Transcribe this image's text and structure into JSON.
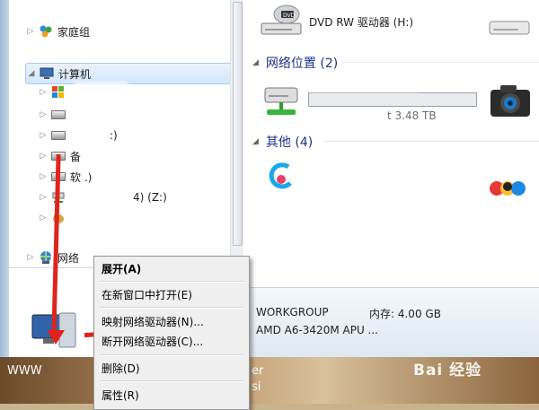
{
  "nav": {
    "items": [
      {
        "label": "家庭组",
        "name": "homegroup"
      },
      {
        "label": "计算机",
        "name": "computer"
      },
      {
        "label": "",
        "name": "drive-1"
      },
      {
        "label": "",
        "name": "drive-2"
      },
      {
        "label": ":)",
        "name": "drive-3"
      },
      {
        "label": "备",
        "name": "drive-4"
      },
      {
        "label": "软 .)",
        "name": "drive-5"
      },
      {
        "label": "4) (Z:)",
        "name": "drive-z"
      },
      {
        "label": "",
        "name": "drive-7"
      },
      {
        "label": "网络",
        "name": "network"
      }
    ]
  },
  "content": {
    "dvd_label": "DVD RW 驱动器 (H:)",
    "network_header": "网络位置 (2)",
    "network_size": "t 3.48 TB",
    "other_header": "其他 (4)"
  },
  "details": {
    "workgroup": "WORKGROUP",
    "memory": "内存: 4.00 GB",
    "cpu": "AMD A6-3420M APU ..."
  },
  "context_menu": {
    "items": [
      {
        "label": "展开(A)"
      },
      {
        "label": "在新窗口中打开(E)"
      },
      {
        "label": "映射网络驱动器(N)..."
      },
      {
        "label": "断开网络驱动器(C)..."
      },
      {
        "label": "删除(D)"
      },
      {
        "label": "属性(R)"
      }
    ]
  },
  "taskbar": {
    "www_text": "WWW",
    "er_text": "er",
    "si_text": "si"
  },
  "watermark": {
    "text": "Bai 经验"
  }
}
